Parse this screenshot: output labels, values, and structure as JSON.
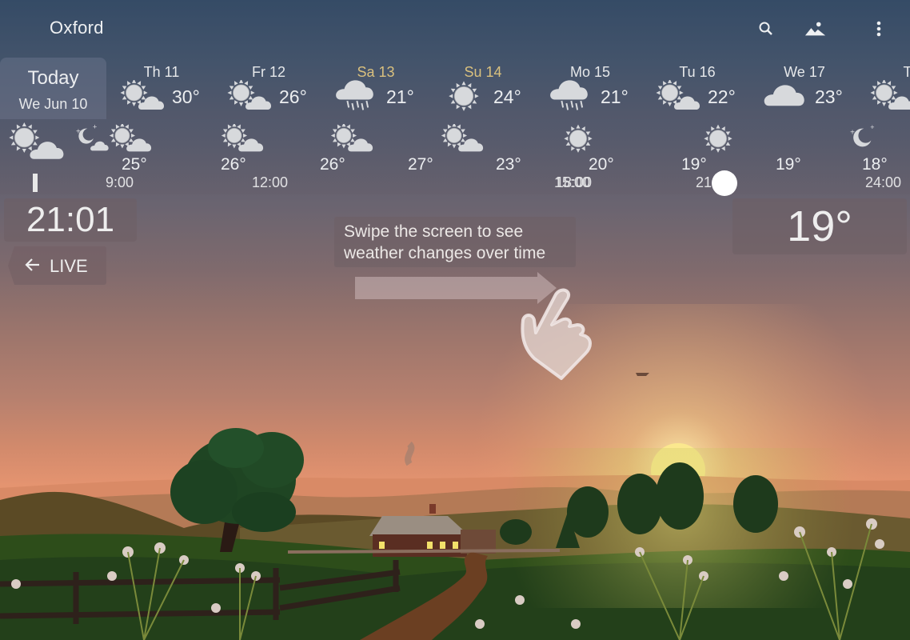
{
  "header": {
    "city": "Oxford",
    "icons": [
      "search-icon",
      "landscape-icon",
      "more-vert-icon"
    ]
  },
  "daily": {
    "today": {
      "label": "Today",
      "date": "We Jun 10"
    },
    "days": [
      {
        "label": "Th 11",
        "icon": "partly-cloudy",
        "temp": "30°",
        "weekend": false
      },
      {
        "label": "Fr 12",
        "icon": "partly-cloudy",
        "temp": "26°",
        "weekend": false
      },
      {
        "label": "Sa 13",
        "icon": "rain",
        "temp": "21°",
        "weekend": true
      },
      {
        "label": "Su 14",
        "icon": "sunny",
        "temp": "24°",
        "weekend": true
      },
      {
        "label": "Mo 15",
        "icon": "rain",
        "temp": "21°",
        "weekend": false
      },
      {
        "label": "Tu 16",
        "icon": "partly-cloudy",
        "temp": "22°",
        "weekend": false
      },
      {
        "label": "We 17",
        "icon": "cloudy",
        "temp": "23°",
        "weekend": false
      },
      {
        "label": "Th",
        "icon": "partly-cloudy",
        "temp": "",
        "weekend": false
      }
    ],
    "weekend_color": "#d9c07e"
  },
  "hourly": {
    "current_icon": "partly-cloudy",
    "entries": [
      {
        "icon": "night-partly-cloudy",
        "temp": "",
        "time": ""
      },
      {
        "icon": "partly-cloudy",
        "temp": "25°",
        "time": "9:00"
      },
      {
        "icon": "partly-cloudy",
        "temp": "26°",
        "time": "12:00"
      },
      {
        "icon": "partly-cloudy",
        "temp": "26°",
        "time": ""
      },
      {
        "icon": "partly-cloudy",
        "temp": "27°",
        "time": "15:00"
      },
      {
        "icon": "",
        "temp": "23°",
        "time": ""
      },
      {
        "icon": "sunny",
        "temp": "20°",
        "time": "18:00"
      },
      {
        "icon": "sunny",
        "temp": "19°",
        "time": "21:00"
      },
      {
        "icon": "",
        "temp": "19°",
        "time": ""
      },
      {
        "icon": "night-clear",
        "temp": "18°",
        "time": "24:00"
      }
    ]
  },
  "current": {
    "time": "21:01",
    "live_label": "LIVE",
    "temperature": "19°"
  },
  "hint": {
    "line1": "Swipe the screen to see",
    "line2": "weather changes over time"
  }
}
